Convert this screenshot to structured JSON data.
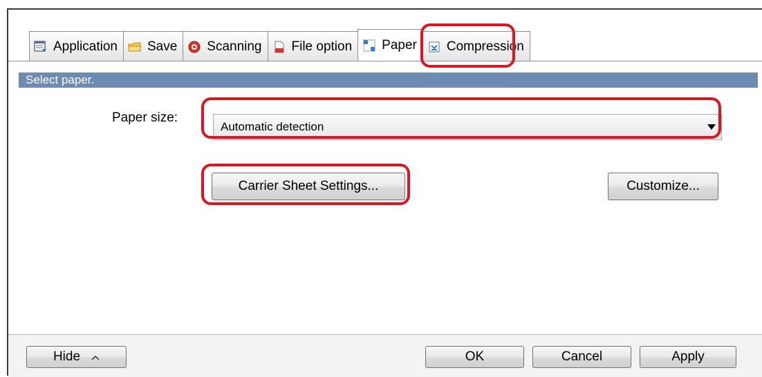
{
  "tabs": [
    {
      "label": "Application",
      "icon": "application-icon",
      "active": false
    },
    {
      "label": "Save",
      "icon": "folder-icon",
      "active": false
    },
    {
      "label": "Scanning",
      "icon": "scanning-icon",
      "active": false
    },
    {
      "label": "File option",
      "icon": "file-option-icon",
      "active": false
    },
    {
      "label": "Paper",
      "icon": "paper-icon",
      "active": true
    },
    {
      "label": "Compression",
      "icon": "compression-icon",
      "active": false
    }
  ],
  "section_header": "Select paper.",
  "paper_size": {
    "label": "Paper size:",
    "value": "Automatic detection"
  },
  "buttons": {
    "carrier_sheet": "Carrier Sheet Settings...",
    "customize": "Customize...",
    "hide": "Hide",
    "ok": "OK",
    "cancel": "Cancel",
    "apply": "Apply"
  },
  "colors": {
    "header_bar": "#6e8bb1",
    "highlight": "#e0141e"
  }
}
